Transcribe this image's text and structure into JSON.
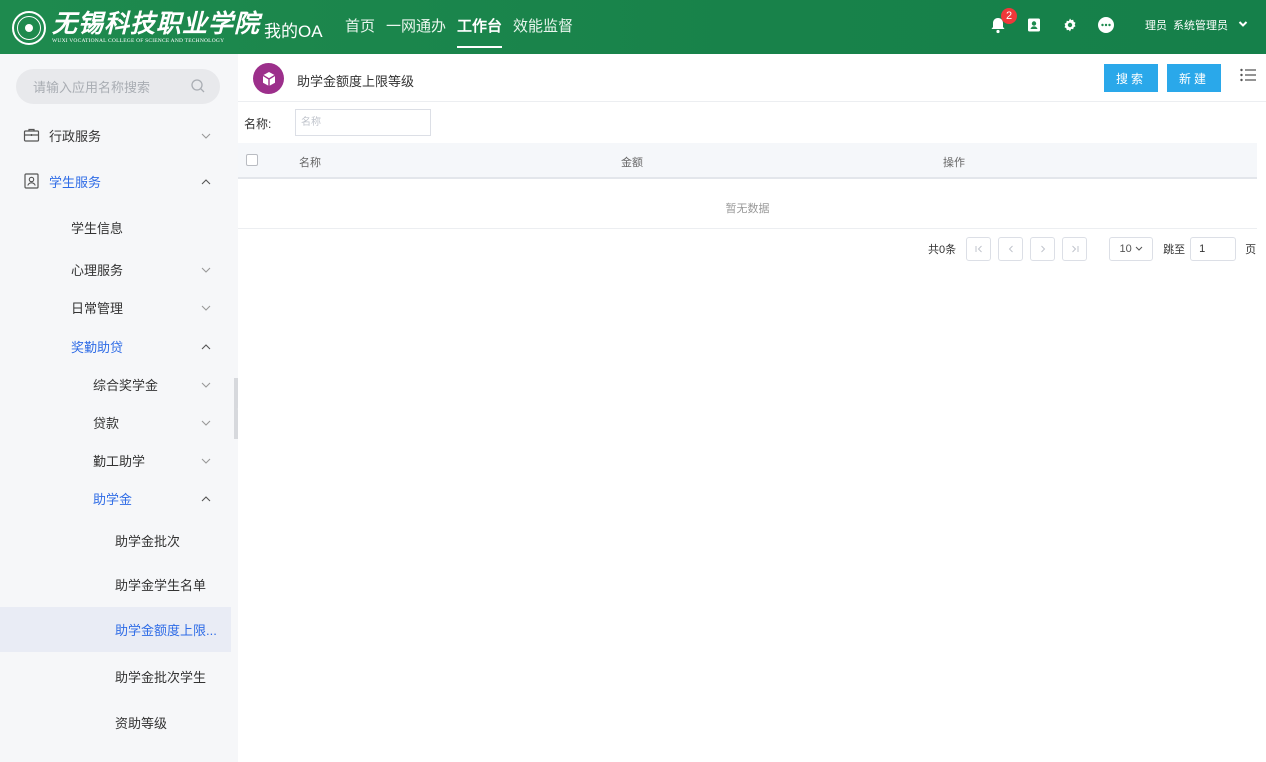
{
  "header": {
    "logo_cn": "无锡科技职业学院",
    "logo_en": "WUXI VOCATIONAL COLLEGE OF SCIENCE AND TECHNOLOGY",
    "brand": "我的OA",
    "nav": [
      "首页",
      "一网通办",
      "工作台",
      "效能监督"
    ],
    "active_nav": "工作台",
    "notification_count": "2",
    "user_role": "理员",
    "user_name": "系统管理员"
  },
  "sidebar": {
    "search_placeholder": "请输入应用名称搜索",
    "items": {
      "admin": "行政服务",
      "student": "学生服务",
      "student_info": "学生信息",
      "psych": "心理服务",
      "daily": "日常管理",
      "reward": "奖勤助贷",
      "scholarship": "综合奖学金",
      "loan": "贷款",
      "workstudy": "勤工助学",
      "grant": "助学金",
      "grant_batch": "助学金批次",
      "grant_list": "助学金学生名单",
      "grant_limit": "助学金额度上限...",
      "grant_batch_student": "助学金批次学生",
      "aid_level": "资助等级"
    }
  },
  "content": {
    "title": "助学金额度上限等级",
    "search_btn": "搜索",
    "new_btn": "新建",
    "filter_label": "名称:",
    "filter_placeholder": "名称",
    "columns": [
      "名称",
      "金额",
      "操作"
    ],
    "empty_text": "暂无数据",
    "pager": {
      "total": "共0条",
      "page_size": "10",
      "jump_label": "跳至",
      "jump_value": "1",
      "page_unit": "页"
    }
  },
  "colors": {
    "topbar": "#1e8a4e",
    "accent": "#2f6ce6",
    "button": "#2aa8ea",
    "app_icon": "#9c2f8b",
    "badge": "#f0373a"
  }
}
